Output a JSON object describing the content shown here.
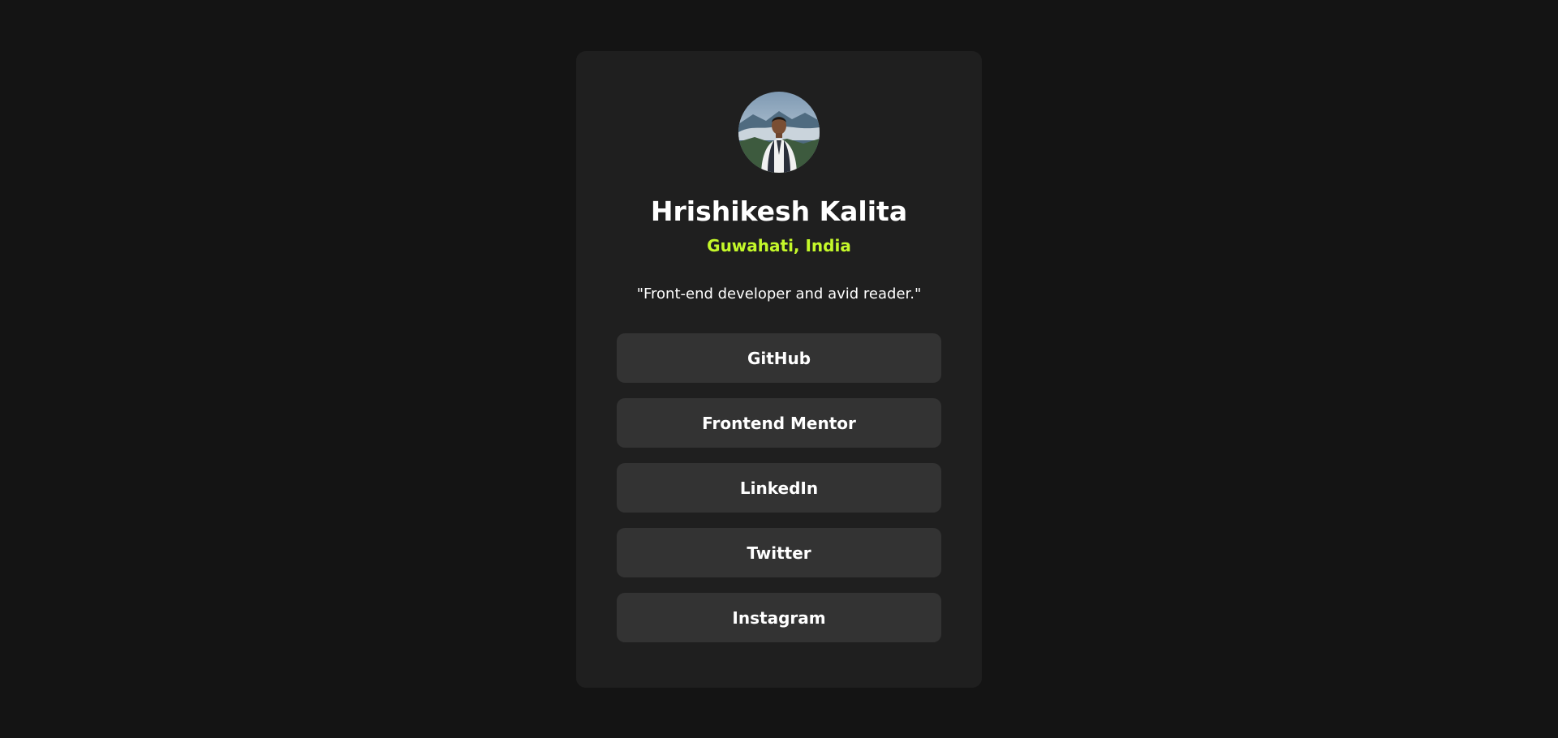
{
  "profile": {
    "name": "Hrishikesh Kalita",
    "location": "Guwahati, India",
    "bio": "\"Front-end developer and avid reader.\"",
    "avatar_icon": "profile-photo"
  },
  "links": [
    {
      "label": "GitHub"
    },
    {
      "label": "Frontend Mentor"
    },
    {
      "label": "LinkedIn"
    },
    {
      "label": "Twitter"
    },
    {
      "label": "Instagram"
    }
  ],
  "colors": {
    "page_background": "#141414",
    "card_background": "#1f1f1f",
    "button_background": "#333333",
    "accent": "#c4f82a",
    "text": "#ffffff"
  }
}
